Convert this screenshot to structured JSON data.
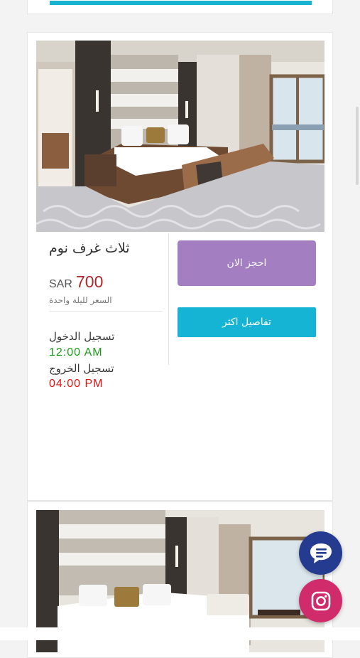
{
  "room": {
    "title": "ثلاث غرف نوم",
    "currency": "SAR",
    "price": "700",
    "price_note": "السعر لليلة واحدة",
    "checkin_label": "تسجيل الدخول",
    "checkin_time": "12:00 AM",
    "checkout_label": "تسجيل الخروج",
    "checkout_time": "04:00 PM"
  },
  "actions": {
    "book_now": "احجز الان",
    "more_details": "تفاصيل اكثر"
  },
  "colors": {
    "book_button": "#a37ec0",
    "details_button": "#16b4d4",
    "price": "#b0262a",
    "checkin_time": "#1a9c1a",
    "checkout_time": "#e0120f",
    "chat_fab": "#243b8f",
    "instagram_fab": "#d02b6b"
  },
  "icons": {
    "chat": "chat-bubble-icon",
    "instagram": "instagram-icon"
  }
}
